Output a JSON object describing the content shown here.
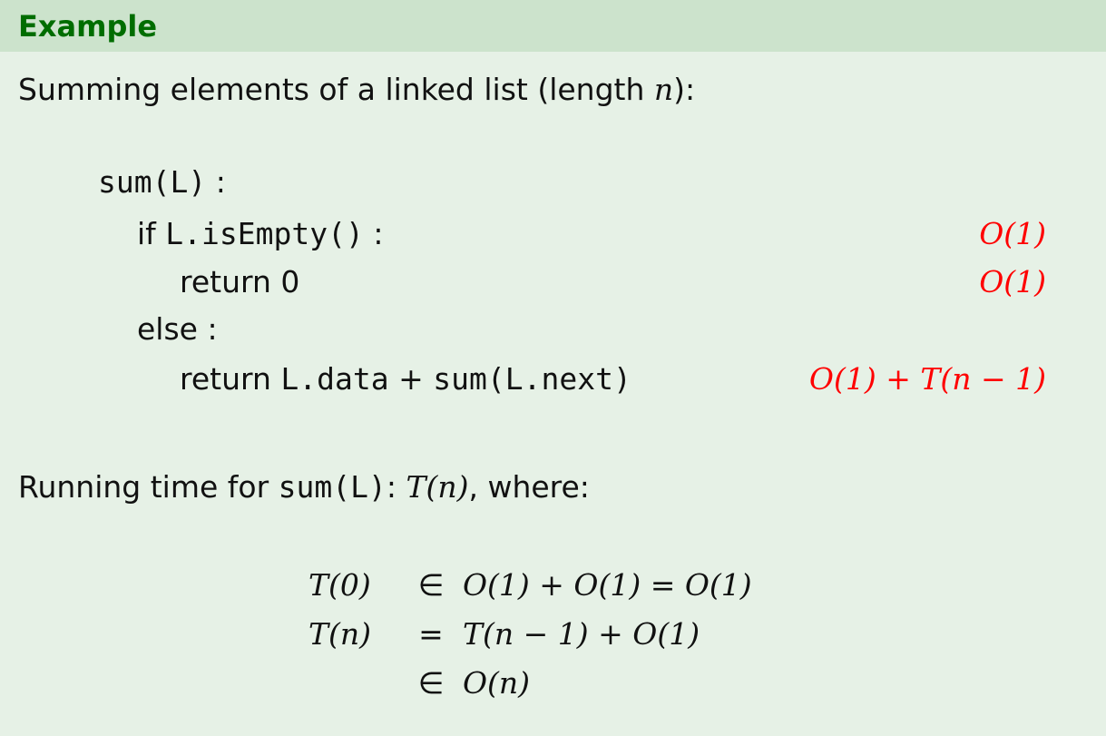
{
  "header": {
    "title": "Example"
  },
  "intro": {
    "text": "Summing elements of a linked list (length ",
    "var": "n",
    "close": "):"
  },
  "code": {
    "line1": {
      "fn": "sum(L)",
      "sep": " :"
    },
    "line2": {
      "kw": "if ",
      "expr": "L.isEmpty()",
      "sep": " :",
      "cost": "O(1)"
    },
    "line3": {
      "text": "return 0",
      "cost": "O(1)"
    },
    "line4": {
      "text": "else :"
    },
    "line5": {
      "kw": "return ",
      "a": "L.data",
      "plus": " + ",
      "b": "sum(L.next)",
      "cost": "O(1) + T(n − 1)"
    }
  },
  "running": {
    "prefix": "Running time for ",
    "fn": "sum(L)",
    "mid": ": ",
    "t": "T(n)",
    "suffix": ", where:"
  },
  "equations": [
    {
      "lhs": "T(0)",
      "op": "∈",
      "rhs": "O(1) + O(1) = O(1)"
    },
    {
      "lhs": "T(n)",
      "op": "=",
      "rhs": "T(n − 1) + O(1)"
    },
    {
      "lhs": "",
      "op": "∈",
      "rhs": "O(n)"
    }
  ]
}
